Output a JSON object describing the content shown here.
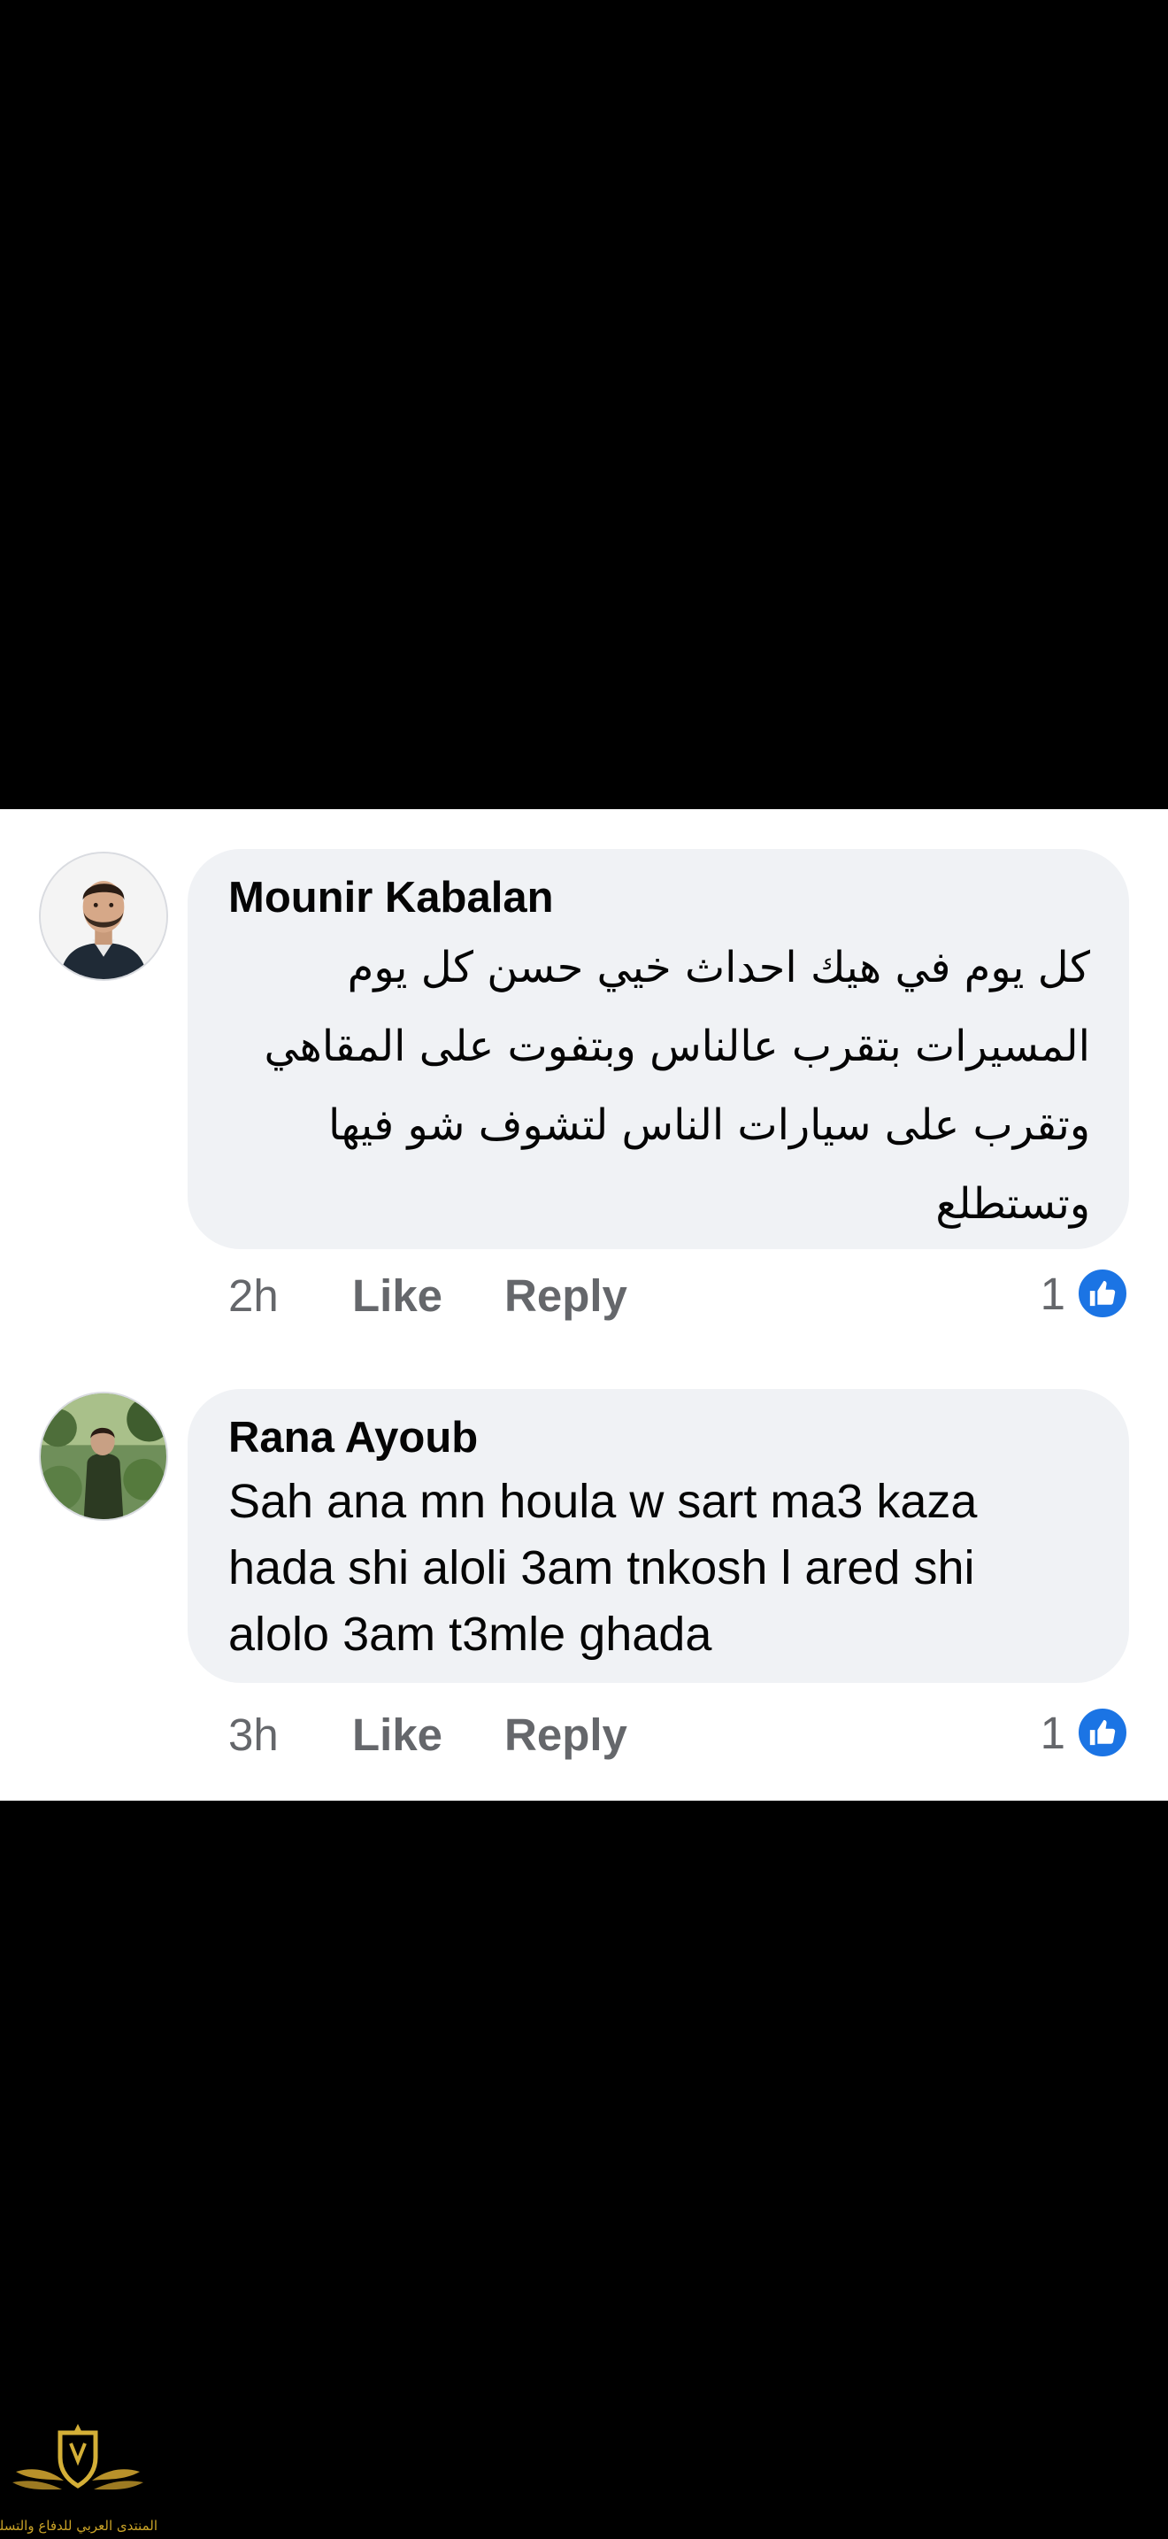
{
  "colors": {
    "background": "#000000",
    "panel": "#ffffff",
    "bubble": "#f0f2f5",
    "meta_text": "#65676b",
    "like_badge": "#1b74e4"
  },
  "comments": [
    {
      "author": "Mounir Kabalan",
      "text_lines": [
        "كل يوم في هيك احداث خيي حسن كل يوم",
        "المسيرات بتقرب عالناس وبتفوت على المقاهي",
        "وتقرب على سيارات الناس لتشوف شو فيها",
        "وتستطلع"
      ],
      "time": "2h",
      "like_label": "Like",
      "reply_label": "Reply",
      "reaction_count": "1",
      "reaction_icon": "thumbs-up-icon",
      "avatar_icon": "profile-photo-man"
    },
    {
      "author": "Rana Ayoub",
      "text_lines": [
        "Sah ana mn houla w sart ma3 kaza",
        "hada shi aloli 3am tnkosh l ared shi",
        "alolo 3am t3mle ghada"
      ],
      "time": "3h",
      "like_label": "Like",
      "reply_label": "Reply",
      "reaction_count": "1",
      "reaction_icon": "thumbs-up-icon",
      "avatar_icon": "profile-photo-outdoor"
    }
  ],
  "watermark": {
    "text": "المنتدى العربي للدفاع والتسليح",
    "icon": "winged-shield-logo"
  }
}
